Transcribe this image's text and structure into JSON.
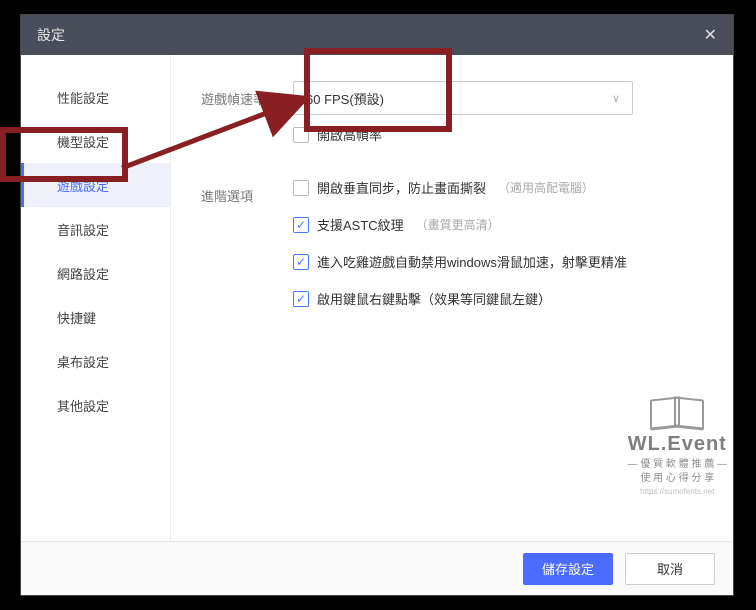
{
  "window": {
    "title": "設定"
  },
  "sidebar": {
    "items": [
      {
        "label": "性能設定"
      },
      {
        "label": "機型設定"
      },
      {
        "label": "遊戲設定",
        "active": true
      },
      {
        "label": "音訊設定"
      },
      {
        "label": "網路設定"
      },
      {
        "label": "快捷鍵"
      },
      {
        "label": "桌布設定"
      },
      {
        "label": "其他設定"
      }
    ]
  },
  "fps": {
    "label": "遊戲幀速率",
    "selected": "60 FPS(預設)",
    "high_fps_label": "開啟高幀率"
  },
  "advanced": {
    "label": "進階選項",
    "items": [
      {
        "checked": false,
        "text": "開啟垂直同步，防止畫面撕裂",
        "hint": "（適用高配電腦）"
      },
      {
        "checked": true,
        "text": "支援ASTC紋理",
        "hint": "（畫質更高清）"
      },
      {
        "checked": true,
        "text": "進入吃雞遊戲自動禁用windows滑鼠加速，射擊更精准",
        "hint": ""
      },
      {
        "checked": true,
        "text": "啟用鍵鼠右鍵點擊（效果等同鍵鼠左鍵）",
        "hint": ""
      }
    ]
  },
  "footer": {
    "save": "儲存設定",
    "cancel": "取消"
  },
  "watermark": {
    "brand": "WL.Event",
    "line1": "— 優 質 軟 體 推 薦 —",
    "line2": "使 用 心 得 分 享",
    "url": "https://sumofents.net"
  },
  "highlight": {
    "color": "#8a1f23"
  }
}
